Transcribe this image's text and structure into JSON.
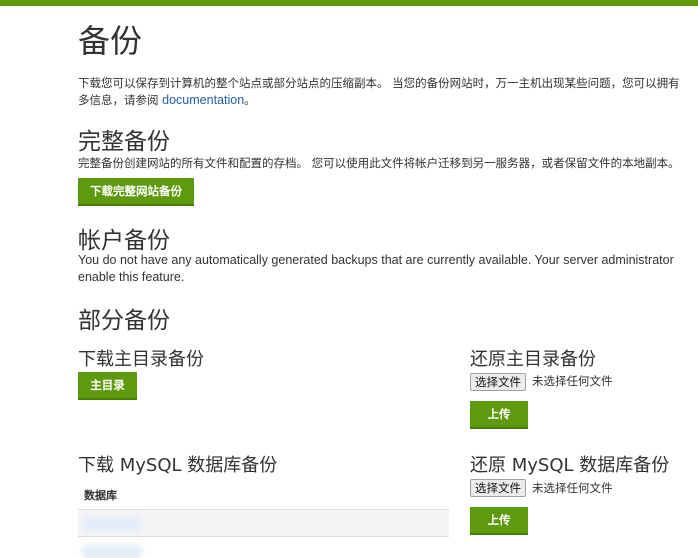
{
  "page": {
    "title": "备份",
    "intro_line1": "下载您可以保存到计算机的整个站点或部分站点的压缩副本。 当您的备份网站时，万一主机出现某些问题，您可以拥有",
    "intro_line2_prefix": "多信息，请参阅 ",
    "intro_link": "documentation",
    "intro_line2_suffix": "。"
  },
  "full_backup": {
    "heading": "完整备份",
    "description": "完整备份创建网站的所有文件和配置的存档。 您可以使用此文件将帐户迁移到另一服务器，或者保留文件的本地副本。",
    "button": "下载完整网站备份"
  },
  "account_backup": {
    "heading": "帐户备份",
    "description_line1": "You do not have any automatically generated backups that are currently available. Your server administrator",
    "description_line2": "enable this feature."
  },
  "partial_backup": {
    "heading": "部分备份",
    "download_home": {
      "heading": "下载主目录备份",
      "button": "主目录"
    },
    "restore_home": {
      "heading": "还原主目录备份",
      "choose_file": "选择文件",
      "no_file": "未选择任何文件",
      "upload": "上传"
    },
    "download_mysql": {
      "heading": "下载 MySQL 数据库备份",
      "table_header": "数据库"
    },
    "restore_mysql": {
      "heading": "还原 MySQL 数据库备份",
      "choose_file": "选择文件",
      "no_file": "未选择任何文件",
      "upload": "上传"
    }
  },
  "colors": {
    "accent": "#5e9a0e",
    "link": "#1f5ea8"
  }
}
